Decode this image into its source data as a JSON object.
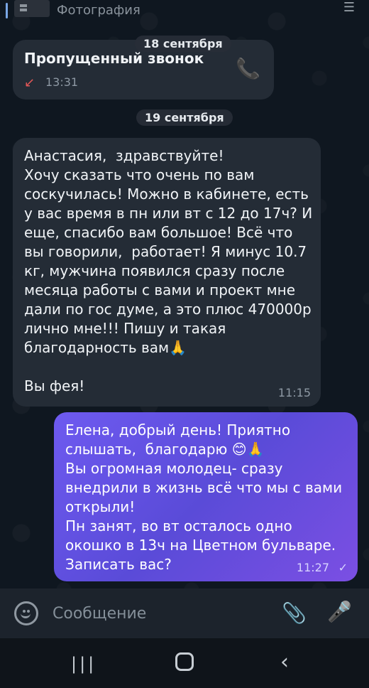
{
  "top": {
    "label": "Фотография"
  },
  "dates": {
    "first": "18 сентября",
    "second": "19 сентября"
  },
  "missed_call": {
    "title": "Пропущенный звонок",
    "time": "13:31"
  },
  "incoming_message": {
    "text": "Анастасия,  здравствуйте!\nХочу сказать что очень по вам соскучилась! Можно в кабинете, есть у вас время в пн или вт с 12 до 17ч? И еще, спасибо вам большое! Всё что вы говорили,  работает! Я минус 10.7 кг, мужчина появился сразу после месяца работы с вами и проект мне дали по гос думе, а это плюс 470000р лично мне!!! Пишу и такая благодарность вам🙏\n\nВы фея!",
    "time": "11:15"
  },
  "outgoing_message": {
    "text": "Елена, добрый день! Приятно слышать,  благодарю 😊🙏\nВы огромная молодец- сразу внедрили в жизнь всё что мы с вами открыли!\nПн занят, во вт осталось одно окошко в 13ч на Цветном бульваре. Записать вас?",
    "time": "11:27"
  },
  "composer": {
    "placeholder": "Сообщение"
  }
}
